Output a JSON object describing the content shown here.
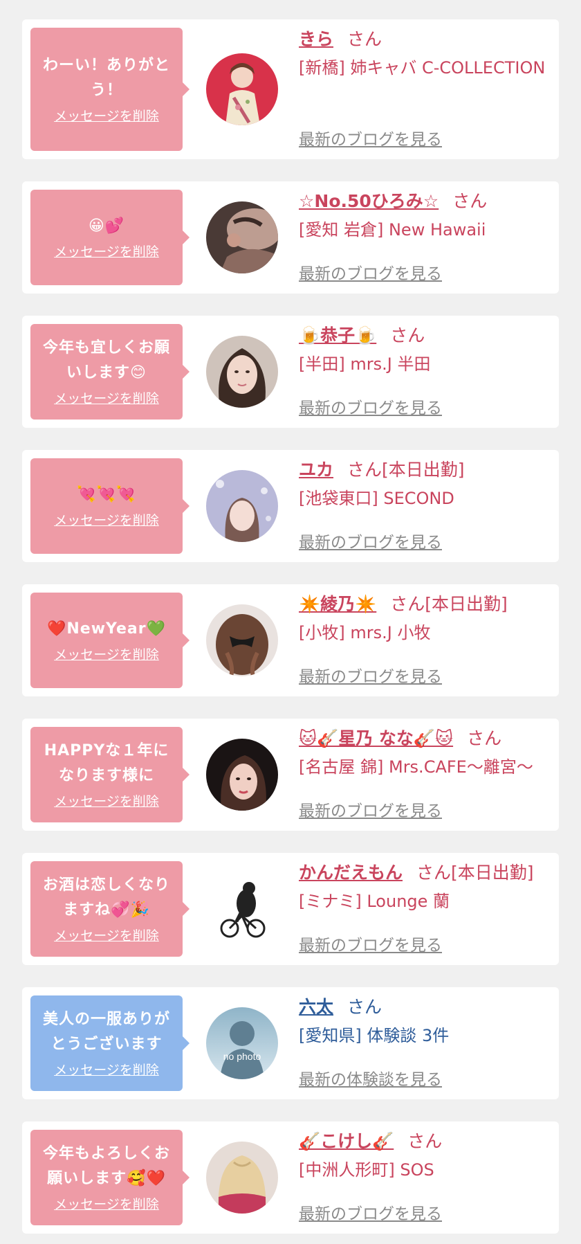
{
  "delete_label": "メッセージを削除",
  "items": [
    {
      "message": "わーい！ありがとう！",
      "name": "きら",
      "honorific": "さん",
      "shop": "[新橋] 姉キャバ C-COLLECTION",
      "link": "最新のブログを見る",
      "theme": "pink",
      "avatar": "kimono-photo"
    },
    {
      "message": "😀💕",
      "name": "☆No.50ひろみ☆",
      "honorific": "さん",
      "shop": "[愛知 岩倉] New Hawaii",
      "link": "最新のブログを見る",
      "theme": "pink",
      "avatar": "love-photo"
    },
    {
      "message": "今年も宜しくお願いします😊",
      "name": "🍺恭子🍺",
      "honorific": "さん",
      "shop": "[半田] mrs.J 半田",
      "link": "最新のブログを見る",
      "theme": "pink",
      "avatar": "woman-photo"
    },
    {
      "message": "💘💘💘",
      "name": "ユカ",
      "honorific": "さん[本日出勤]",
      "shop": "[池袋東口] SECOND",
      "link": "最新のブログを見る",
      "theme": "pink",
      "avatar": "city-photo"
    },
    {
      "message": "❤️NewYear💚",
      "name": "✴️綾乃✴️",
      "honorific": "さん[本日出勤]",
      "shop": "[小牧] mrs.J 小牧",
      "link": "最新のブログを見る",
      "theme": "pink",
      "avatar": "hair-photo"
    },
    {
      "message": "HAPPYな１年になります様に",
      "name": "🐱🎸星乃 なな🎸🐱",
      "honorific": "さん",
      "shop": "[名古屋 錦] Mrs.CAFE〜離宮〜",
      "link": "最新のブログを見る",
      "theme": "pink",
      "avatar": "dark-photo"
    },
    {
      "message": "お酒は恋しくなりますね💞🎉",
      "name": "かんだえもん",
      "honorific": "さん[本日出勤]",
      "shop": "[ミナミ] Lounge 蘭",
      "link": "最新のブログを見る",
      "theme": "pink",
      "avatar": "bicycle-bear"
    },
    {
      "message": "美人の一服ありがとうございます",
      "name": "六太",
      "honorific": "さん",
      "shop": "[愛知県] 体験談 3件",
      "link": "最新の体験談を見る",
      "theme": "blue",
      "avatar": "no-photo",
      "avatar_text": "no photo"
    },
    {
      "message": "今年もよろしくお願いします🥰❤️",
      "name": "🎸こけし🎸",
      "honorific": "さん",
      "shop": "[中洲人形町] SOS",
      "link": "最新のブログを見る",
      "theme": "pink",
      "avatar": "blonde-photo"
    }
  ],
  "colors": {
    "pink_bubble": "#ee9ba6",
    "blue_bubble": "#8fb7ec",
    "pink_text": "#c9445d",
    "blue_text": "#2f5d9a",
    "link_gray": "#8a8a8a"
  }
}
